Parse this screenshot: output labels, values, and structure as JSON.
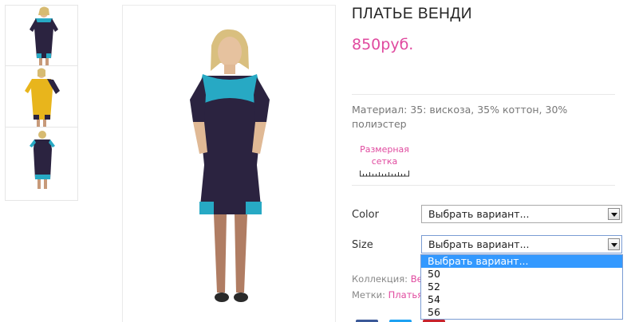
{
  "product": {
    "title": "ПЛАТЬЕ ВЕНДИ",
    "price": "850руб.",
    "material": "Материал: 35: вискоза, 35% коттон, 30% полиэстер",
    "size_chart_label": "Размерная сетка"
  },
  "variations": {
    "color": {
      "label": "Color",
      "value": "Выбрать вариант..."
    },
    "size": {
      "label": "Size",
      "value": "Выбрать вариант...",
      "options": [
        "Выбрать вариант...",
        "50",
        "52",
        "54",
        "56"
      ]
    }
  },
  "meta": {
    "collection_label": "Коллекция:",
    "collection_value": "Ве",
    "tags_label": "Метки:",
    "tags_value": "Платья"
  },
  "colors": {
    "price": "#e04a9f",
    "dress_navy": "#2b2340",
    "dress_turquoise": "#27a9c4",
    "dress_yellow": "#e8b51c",
    "dropdown_highlight": "#3399ff"
  },
  "icons": [
    "size-chart-ruler-icon",
    "dropdown-arrow-icon"
  ]
}
